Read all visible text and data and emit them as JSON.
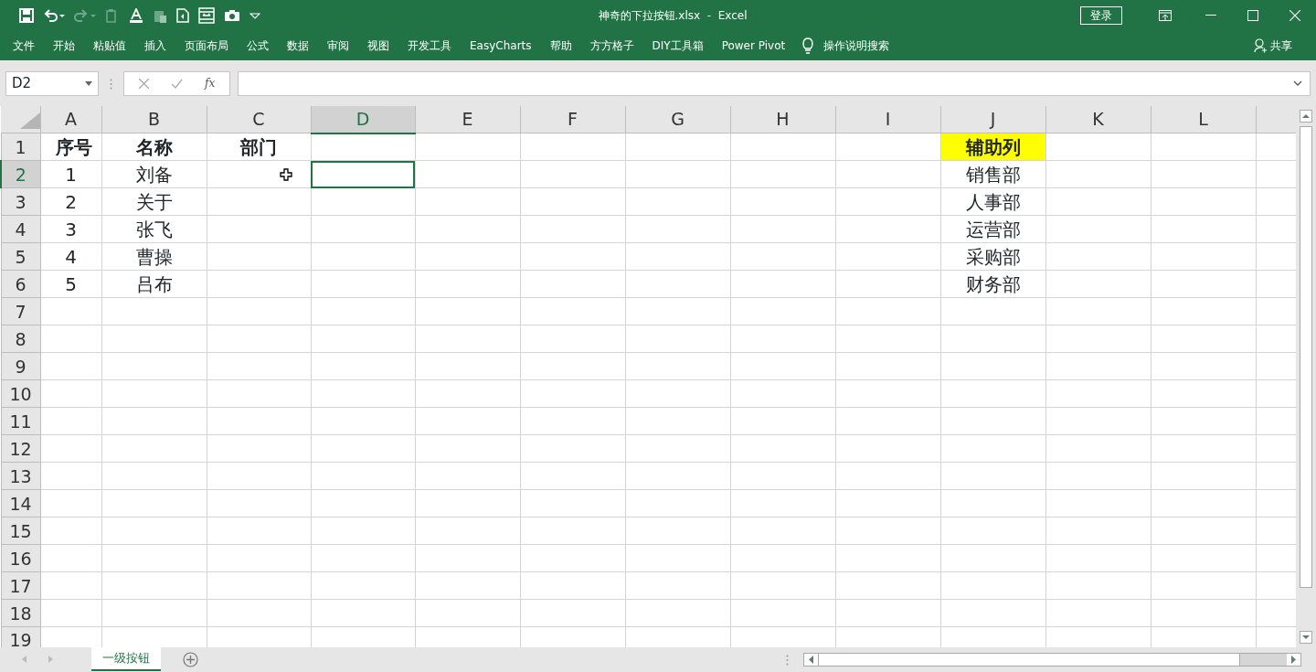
{
  "window": {
    "title": "神奇的下拉按钮.xlsx  -  Excel",
    "sign_in": "登录"
  },
  "ribbon_tabs": [
    {
      "label": "文件"
    },
    {
      "label": "开始"
    },
    {
      "label": "粘贴值"
    },
    {
      "label": "插入"
    },
    {
      "label": "页面布局"
    },
    {
      "label": "公式"
    },
    {
      "label": "数据"
    },
    {
      "label": "审阅"
    },
    {
      "label": "视图"
    },
    {
      "label": "开发工具"
    },
    {
      "label": "EasyCharts"
    },
    {
      "label": "帮助"
    },
    {
      "label": "方方格子"
    },
    {
      "label": "DIY工具箱"
    },
    {
      "label": "Power Pivot"
    }
  ],
  "tell_me": "操作说明搜索",
  "share": "共享",
  "formula_bar": {
    "name_box": "D2",
    "function_label": "fx"
  },
  "sheet": {
    "columns": [
      {
        "label": "A",
        "selected": false
      },
      {
        "label": "B",
        "selected": false
      },
      {
        "label": "C",
        "selected": false
      },
      {
        "label": "D",
        "selected": true
      },
      {
        "label": "E",
        "selected": false
      },
      {
        "label": "F",
        "selected": false
      },
      {
        "label": "G",
        "selected": false
      },
      {
        "label": "H",
        "selected": false
      },
      {
        "label": "I",
        "selected": false
      },
      {
        "label": "J",
        "selected": false
      },
      {
        "label": "K",
        "selected": false
      },
      {
        "label": "L",
        "selected": false
      }
    ],
    "rows": [
      {
        "number": "1",
        "selected": false,
        "cells": {
          "A": {
            "text": "序号",
            "bold": true,
            "highlighted": false
          },
          "B": {
            "text": "名称",
            "bold": true,
            "highlighted": false
          },
          "C": {
            "text": "部门",
            "bold": true,
            "highlighted": false
          },
          "J": {
            "text": "辅助列",
            "bold": true,
            "highlighted": true
          }
        }
      },
      {
        "number": "2",
        "selected": true,
        "cells": {
          "A": {
            "text": "1",
            "bold": false,
            "highlighted": false
          },
          "B": {
            "text": "刘备",
            "bold": false,
            "highlighted": false
          },
          "J": {
            "text": "销售部",
            "bold": false,
            "highlighted": false
          }
        }
      },
      {
        "number": "3",
        "selected": false,
        "cells": {
          "A": {
            "text": "2",
            "bold": false,
            "highlighted": false
          },
          "B": {
            "text": "关于",
            "bold": false,
            "highlighted": false
          },
          "J": {
            "text": "人事部",
            "bold": false,
            "highlighted": false
          }
        }
      },
      {
        "number": "4",
        "selected": false,
        "cells": {
          "A": {
            "text": "3",
            "bold": false,
            "highlighted": false
          },
          "B": {
            "text": "张飞",
            "bold": false,
            "highlighted": false
          },
          "J": {
            "text": "运营部",
            "bold": false,
            "highlighted": false
          }
        }
      },
      {
        "number": "5",
        "selected": false,
        "cells": {
          "A": {
            "text": "4",
            "bold": false,
            "highlighted": false
          },
          "B": {
            "text": "曹操",
            "bold": false,
            "highlighted": false
          },
          "J": {
            "text": "采购部",
            "bold": false,
            "highlighted": false
          }
        }
      },
      {
        "number": "6",
        "selected": false,
        "cells": {
          "A": {
            "text": "5",
            "bold": false,
            "highlighted": false
          },
          "B": {
            "text": "吕布",
            "bold": false,
            "highlighted": false
          },
          "J": {
            "text": "财务部",
            "bold": false,
            "highlighted": false
          }
        }
      },
      {
        "number": "7",
        "selected": false,
        "cells": {}
      },
      {
        "number": "8",
        "selected": false,
        "cells": {}
      },
      {
        "number": "9",
        "selected": false,
        "cells": {}
      },
      {
        "number": "10",
        "selected": false,
        "cells": {}
      },
      {
        "number": "11",
        "selected": false,
        "cells": {}
      },
      {
        "number": "12",
        "selected": false,
        "cells": {}
      },
      {
        "number": "13",
        "selected": false,
        "cells": {}
      },
      {
        "number": "14",
        "selected": false,
        "cells": {}
      },
      {
        "number": "15",
        "selected": false,
        "cells": {}
      },
      {
        "number": "16",
        "selected": false,
        "cells": {}
      },
      {
        "number": "17",
        "selected": false,
        "cells": {}
      },
      {
        "number": "18",
        "selected": false,
        "cells": {}
      },
      {
        "number": "19",
        "selected": false,
        "cells": {}
      }
    ]
  },
  "sheet_tabs": [
    {
      "label": "一级按钮",
      "selected": true
    }
  ]
}
